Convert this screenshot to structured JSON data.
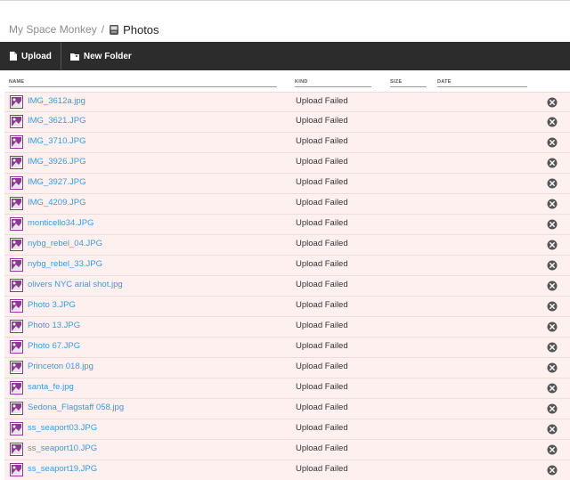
{
  "breadcrumb": {
    "root": "My Space Monkey",
    "separator": "/",
    "current": "Photos",
    "current_icon": "folder-icon"
  },
  "toolbar": {
    "upload_label": "Upload",
    "upload_icon": "upload-file-icon",
    "new_folder_label": "New Folder",
    "new_folder_icon": "folder-plus-icon"
  },
  "columns": {
    "name": "NAME",
    "kind": "KIND",
    "size": "SIZE",
    "date": "DATE"
  },
  "colors": {
    "toolbar_bg": "#2c2c2c",
    "row_bg_failed": "#fff0f0",
    "link": "#3a9ad9",
    "image_icon": "#8b3a8f"
  },
  "files": [
    {
      "name": "IMG_3612a.jpg",
      "kind": "Upload Failed"
    },
    {
      "name": "IMG_3621.JPG",
      "kind": "Upload Failed"
    },
    {
      "name": "IMG_3710.JPG",
      "kind": "Upload Failed"
    },
    {
      "name": "IMG_3926.JPG",
      "kind": "Upload Failed"
    },
    {
      "name": "IMG_3927.JPG",
      "kind": "Upload Failed"
    },
    {
      "name": "IMG_4209.JPG",
      "kind": "Upload Failed"
    },
    {
      "name": "monticello34.JPG",
      "kind": "Upload Failed"
    },
    {
      "name": "nybg_rebel_04.JPG",
      "kind": "Upload Failed"
    },
    {
      "name": "nybg_rebel_33.JPG",
      "kind": "Upload Failed"
    },
    {
      "name": "olivers NYC arial shot.jpg",
      "kind": "Upload Failed"
    },
    {
      "name": "Photo 3.JPG",
      "kind": "Upload Failed"
    },
    {
      "name": "Photo 13.JPG",
      "kind": "Upload Failed"
    },
    {
      "name": "Photo 67.JPG",
      "kind": "Upload Failed"
    },
    {
      "name": "Princeton 018.jpg",
      "kind": "Upload Failed"
    },
    {
      "name": "santa_fe.jpg",
      "kind": "Upload Failed"
    },
    {
      "name": "Sedona_Flagstaff 058.jpg",
      "kind": "Upload Failed"
    },
    {
      "name": "ss_seaport03.JPG",
      "kind": "Upload Failed"
    },
    {
      "name": "ss_seaport10.JPG",
      "kind": "Upload Failed"
    },
    {
      "name": "ss_seaport19.JPG",
      "kind": "Upload Failed"
    }
  ]
}
